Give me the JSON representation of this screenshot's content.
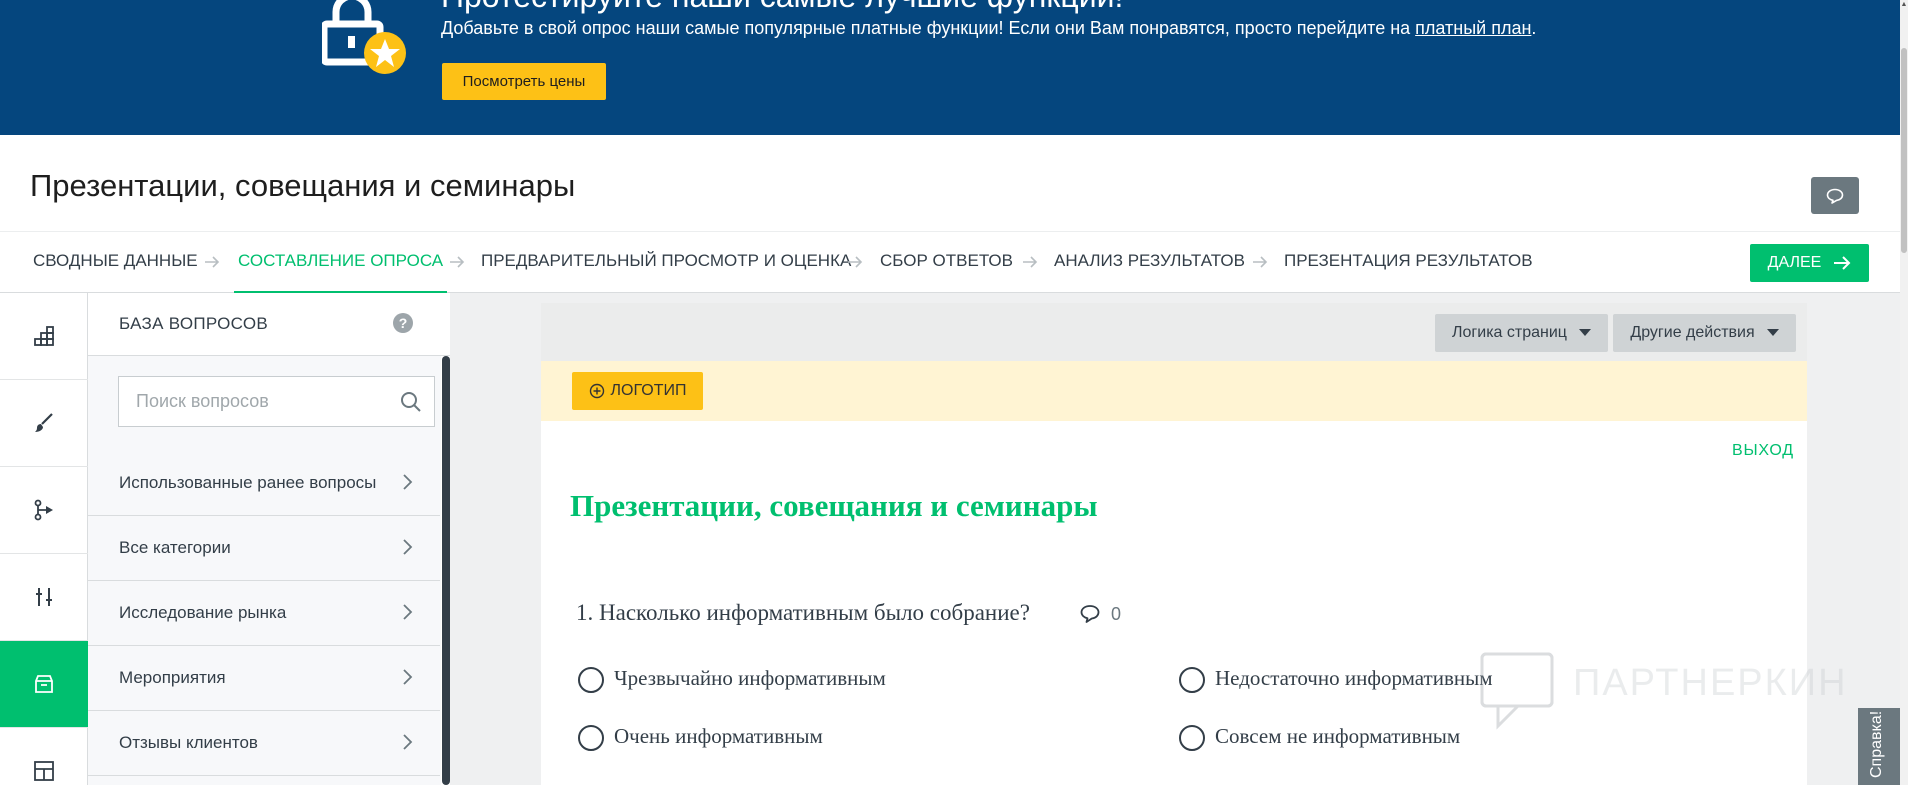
{
  "banner": {
    "headline": "Протестируйте наши самые лучшие функции!",
    "subtext_before_link": "Добавьте в свой опрос наши самые популярные платные функции! Если они Вам понравятся, просто перейдите на ",
    "link_text": "платный план",
    "subtext_after_link": ".",
    "price_button": "Посмотреть цены",
    "icon": "lock-star-icon",
    "background_color": "#05467e",
    "button_color": "#fdc116"
  },
  "header": {
    "survey_title": "Презентации, совещания и семинары",
    "comment_icon": "speech-bubble-icon"
  },
  "steps": {
    "items": [
      {
        "label": "СВОДНЫЕ ДАННЫЕ",
        "active": false
      },
      {
        "label": "СОСТАВЛЕНИЕ ОПРОСА",
        "active": true
      },
      {
        "label": "ПРЕДВАРИТЕЛЬНЫЙ ПРОСМОТР И ОЦЕНКА",
        "active": false
      },
      {
        "label": "СБОР ОТВЕТОВ",
        "active": false
      },
      {
        "label": "АНАЛИЗ РЕЗУЛЬТАТОВ",
        "active": false
      },
      {
        "label": "ПРЕЗЕНТАЦИЯ РЕЗУЛЬТАТОВ",
        "active": false
      }
    ],
    "next_button": "ДАЛЕЕ",
    "accent_color": "#00bf6f"
  },
  "rail": {
    "items": [
      {
        "icon": "building-blocks-icon",
        "active": false
      },
      {
        "icon": "paintbrush-icon",
        "active": false
      },
      {
        "icon": "logic-branch-icon",
        "active": false
      },
      {
        "icon": "sliders-icon",
        "active": false
      },
      {
        "icon": "question-bank-icon",
        "active": true
      },
      {
        "icon": "layout-grid-icon",
        "active": false
      }
    ]
  },
  "bank": {
    "title": "БАЗА ВОПРОСОВ",
    "help": "?",
    "search_placeholder": "Поиск вопросов",
    "search_value": "",
    "items": [
      {
        "label": "Использованные ранее вопросы"
      },
      {
        "label": "Все категории"
      },
      {
        "label": "Исследование рынка"
      },
      {
        "label": "Мероприятия"
      },
      {
        "label": "Отзывы клиентов"
      }
    ]
  },
  "toolbar": {
    "page_logic": "Логика страниц",
    "other_actions": "Другие действия"
  },
  "logo": {
    "button": "ЛОГОТИП"
  },
  "survey": {
    "exit": "ВЫХОД",
    "title": "Презентации, совещания и семинары",
    "question": {
      "text": "1. Насколько информативным было собрание?",
      "comment_count": "0",
      "choices": [
        "Чрезвычайно информативным",
        "Недостаточно информативным",
        "Очень информативным",
        "Совсем не информативным"
      ]
    }
  },
  "watermark": {
    "text": "ПАРТНЕРКИН"
  },
  "help_tab": {
    "label": "Справка!"
  }
}
